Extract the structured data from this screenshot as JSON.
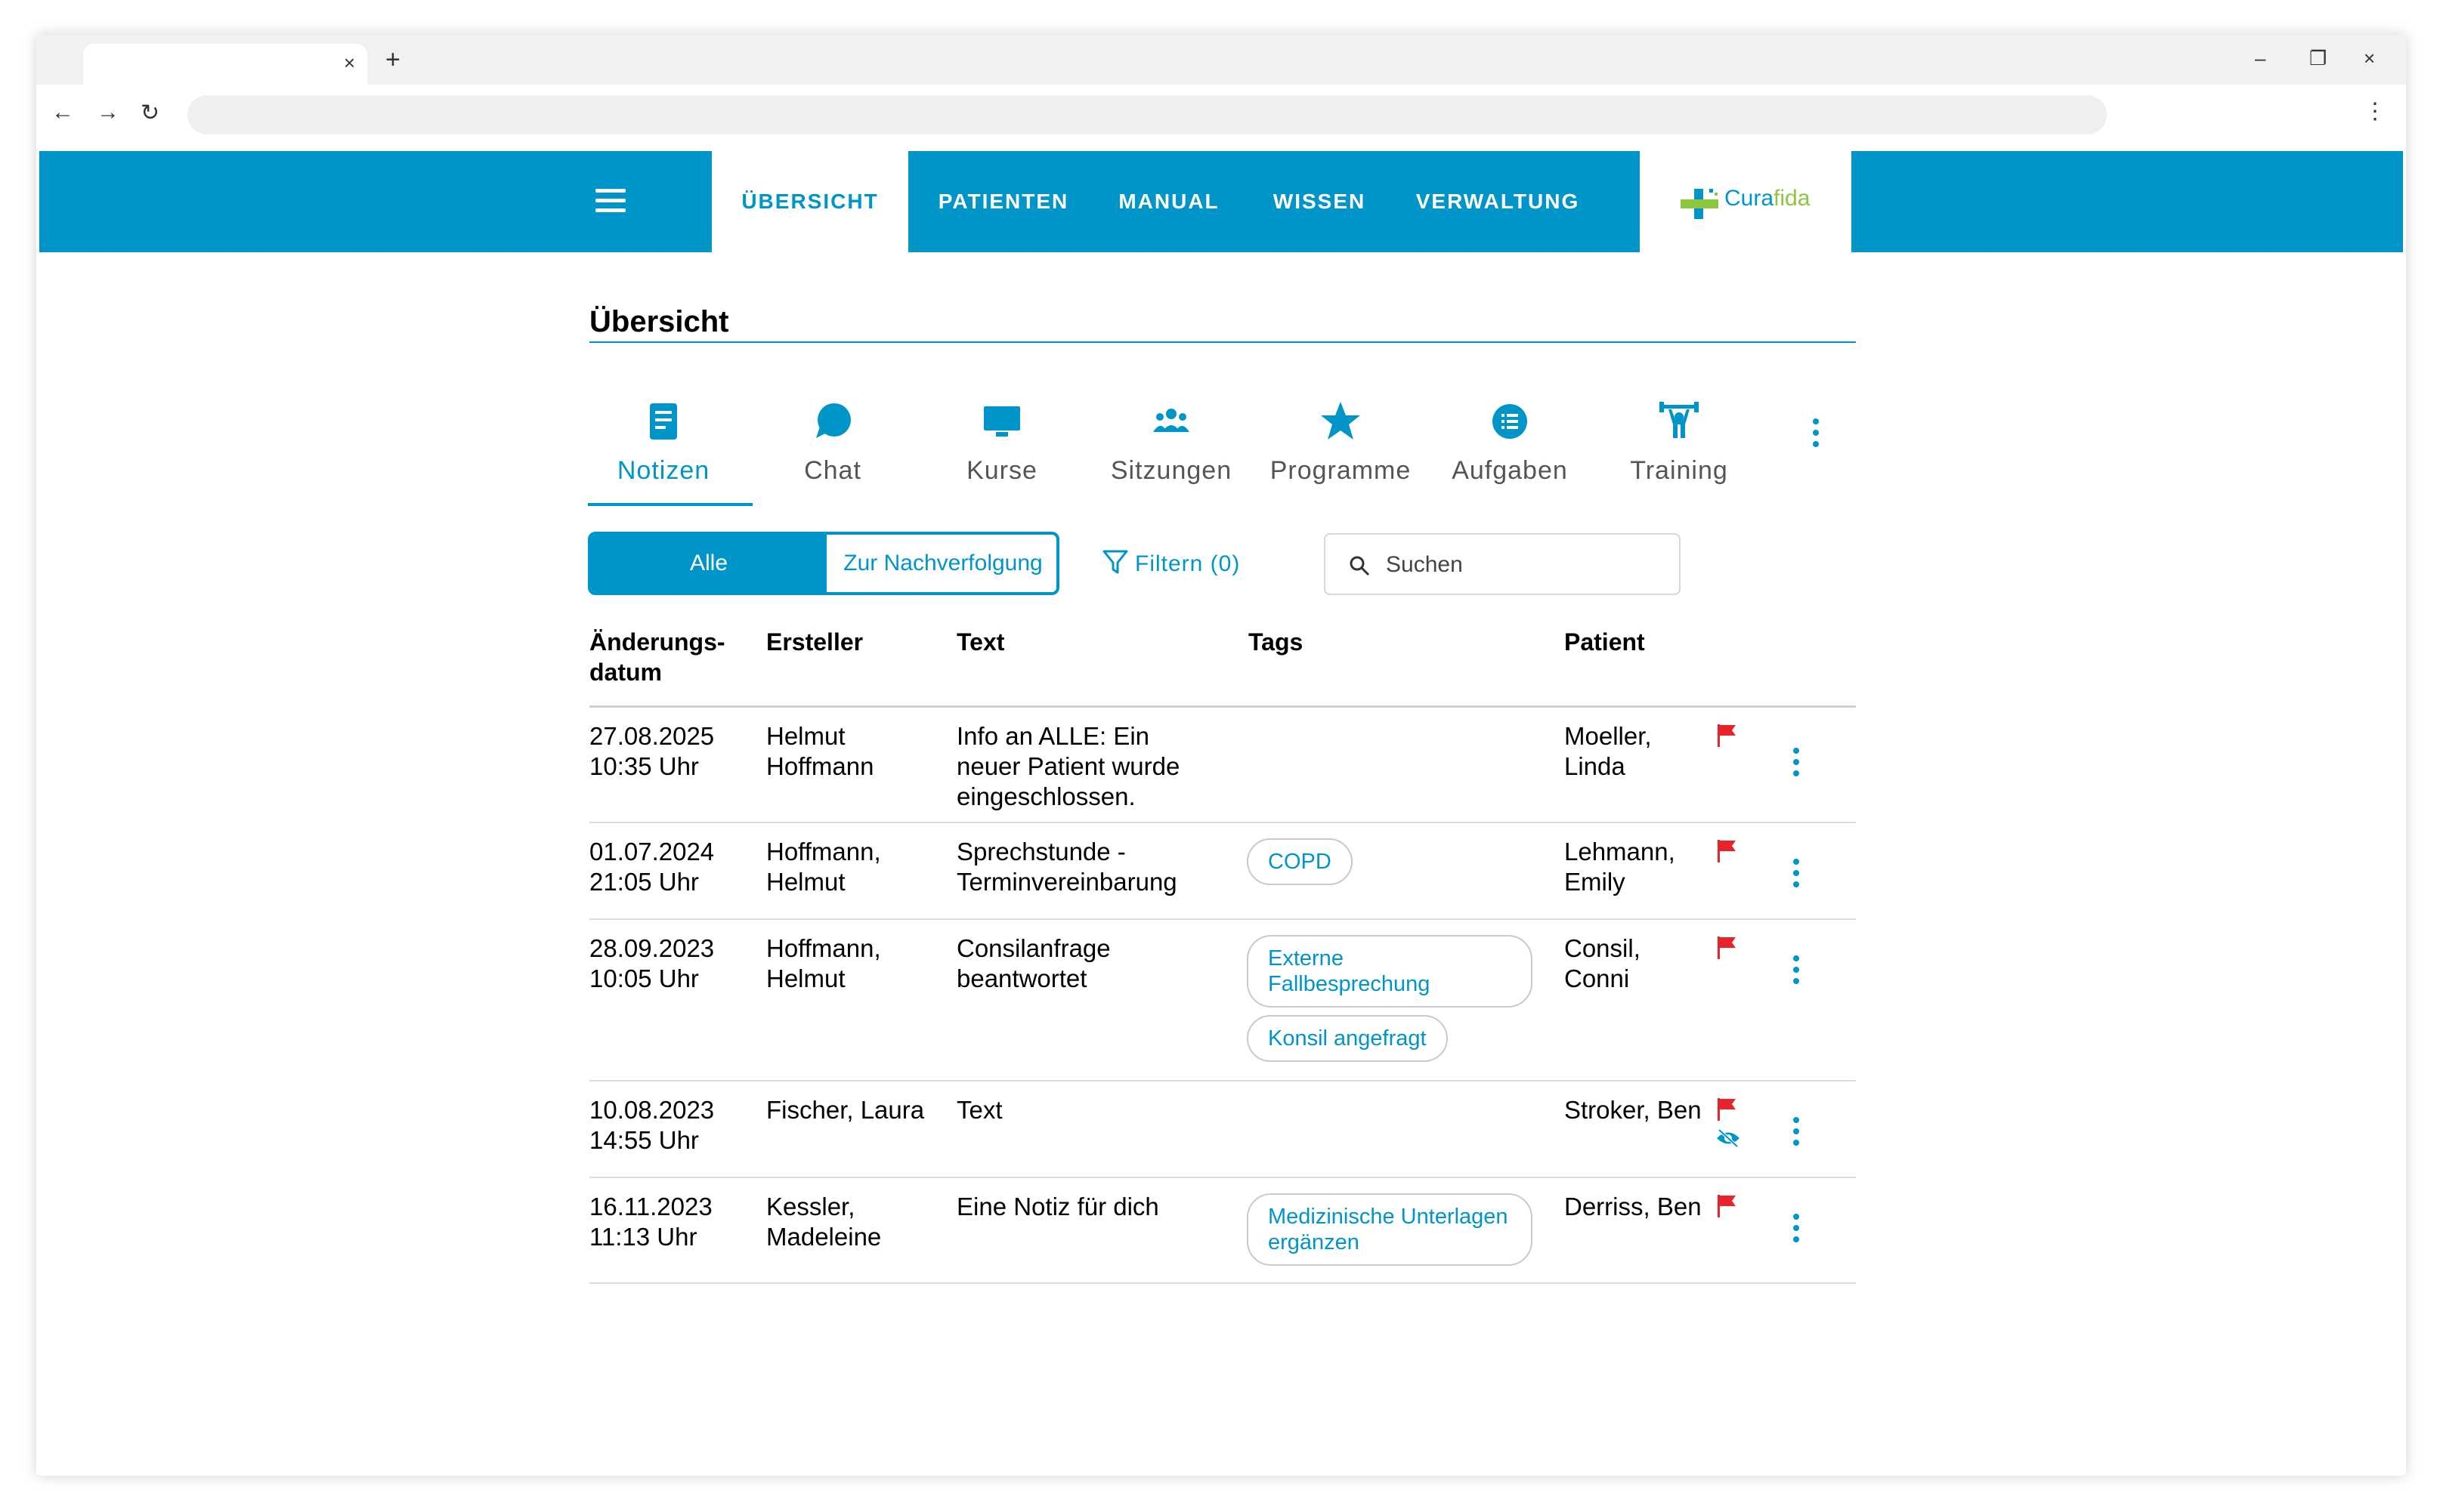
{
  "browser": {
    "tab_close": "×",
    "new_tab": "+",
    "minimize": "–",
    "restore": "❐",
    "close": "×",
    "back": "←",
    "forward": "→",
    "reload": "↻",
    "menu": "⋮"
  },
  "nav": {
    "items": [
      "ÜBERSICHT",
      "PATIENTEN",
      "MANUAL",
      "WISSEN",
      "VERWALTUNG"
    ],
    "active_index": 0,
    "logo_part1": "Cura",
    "logo_part2": "fida"
  },
  "page": {
    "title": "Übersicht"
  },
  "categories": {
    "items": [
      {
        "label": "Notizen",
        "icon": "note-icon"
      },
      {
        "label": "Chat",
        "icon": "chat-icon"
      },
      {
        "label": "Kurse",
        "icon": "monitor-icon"
      },
      {
        "label": "Sitzungen",
        "icon": "group-icon"
      },
      {
        "label": "Programme",
        "icon": "star-icon"
      },
      {
        "label": "Aufgaben",
        "icon": "list-icon"
      },
      {
        "label": "Training",
        "icon": "training-icon"
      }
    ],
    "active_index": 0
  },
  "filters": {
    "all_label": "Alle",
    "follow_label": "Zur Nachverfolgung",
    "filter_label": "Filtern (0)",
    "search_placeholder": "Suchen"
  },
  "table": {
    "headers": {
      "date_line1": "Änderungs-",
      "date_line2": "datum",
      "author": "Ersteller",
      "text": "Text",
      "tags": "Tags",
      "patient": "Patient"
    },
    "rows": [
      {
        "date": "27.08.2025",
        "time": "10:35 Uhr",
        "author_1": "Helmut",
        "author_2": "Hoffmann",
        "text_1": "Info an ALLE: Ein",
        "text_2": "neuer Patient wurde",
        "text_3": "eingeschlossen.",
        "tags": [],
        "patient_1": "Moeller,",
        "patient_2": "Linda",
        "flagged": true,
        "hidden": false
      },
      {
        "date": "01.07.2024",
        "time": "21:05 Uhr",
        "author_1": "Hoffmann,",
        "author_2": "Helmut",
        "text_1": "Sprechstunde -",
        "text_2": "Terminvereinbarung",
        "text_3": "",
        "tags": [
          "COPD"
        ],
        "patient_1": "Lehmann,",
        "patient_2": "Emily",
        "flagged": true,
        "hidden": false
      },
      {
        "date": "28.09.2023",
        "time": "10:05 Uhr",
        "author_1": "Hoffmann,",
        "author_2": "Helmut",
        "text_1": "Consilanfrage",
        "text_2": "beantwortet",
        "text_3": "",
        "tags": [
          "Externe Fallbesprechung",
          "Konsil angefragt"
        ],
        "patient_1": "Consil,",
        "patient_2": "Conni",
        "flagged": true,
        "hidden": false
      },
      {
        "date": "10.08.2023",
        "time": "14:55 Uhr",
        "author_1": "Fischer, Laura",
        "author_2": "",
        "text_1": "Text",
        "text_2": "",
        "text_3": "",
        "tags": [],
        "patient_1": "Stroker, Ben",
        "patient_2": "",
        "flagged": true,
        "hidden": true
      },
      {
        "date": "16.11.2023",
        "time": "11:13 Uhr",
        "author_1": "Kessler,",
        "author_2": "Madeleine",
        "text_1": "Eine Notiz für dich",
        "text_2": "",
        "text_3": "",
        "tags": [
          "Medizinische Unterlagen ergänzen"
        ],
        "patient_1": "Derriss, Ben",
        "patient_2": "",
        "flagged": true,
        "hidden": false
      }
    ]
  },
  "colors": {
    "brand": "#0095c8",
    "flag": "#e8232a",
    "logo_green": "#8cc63f"
  }
}
